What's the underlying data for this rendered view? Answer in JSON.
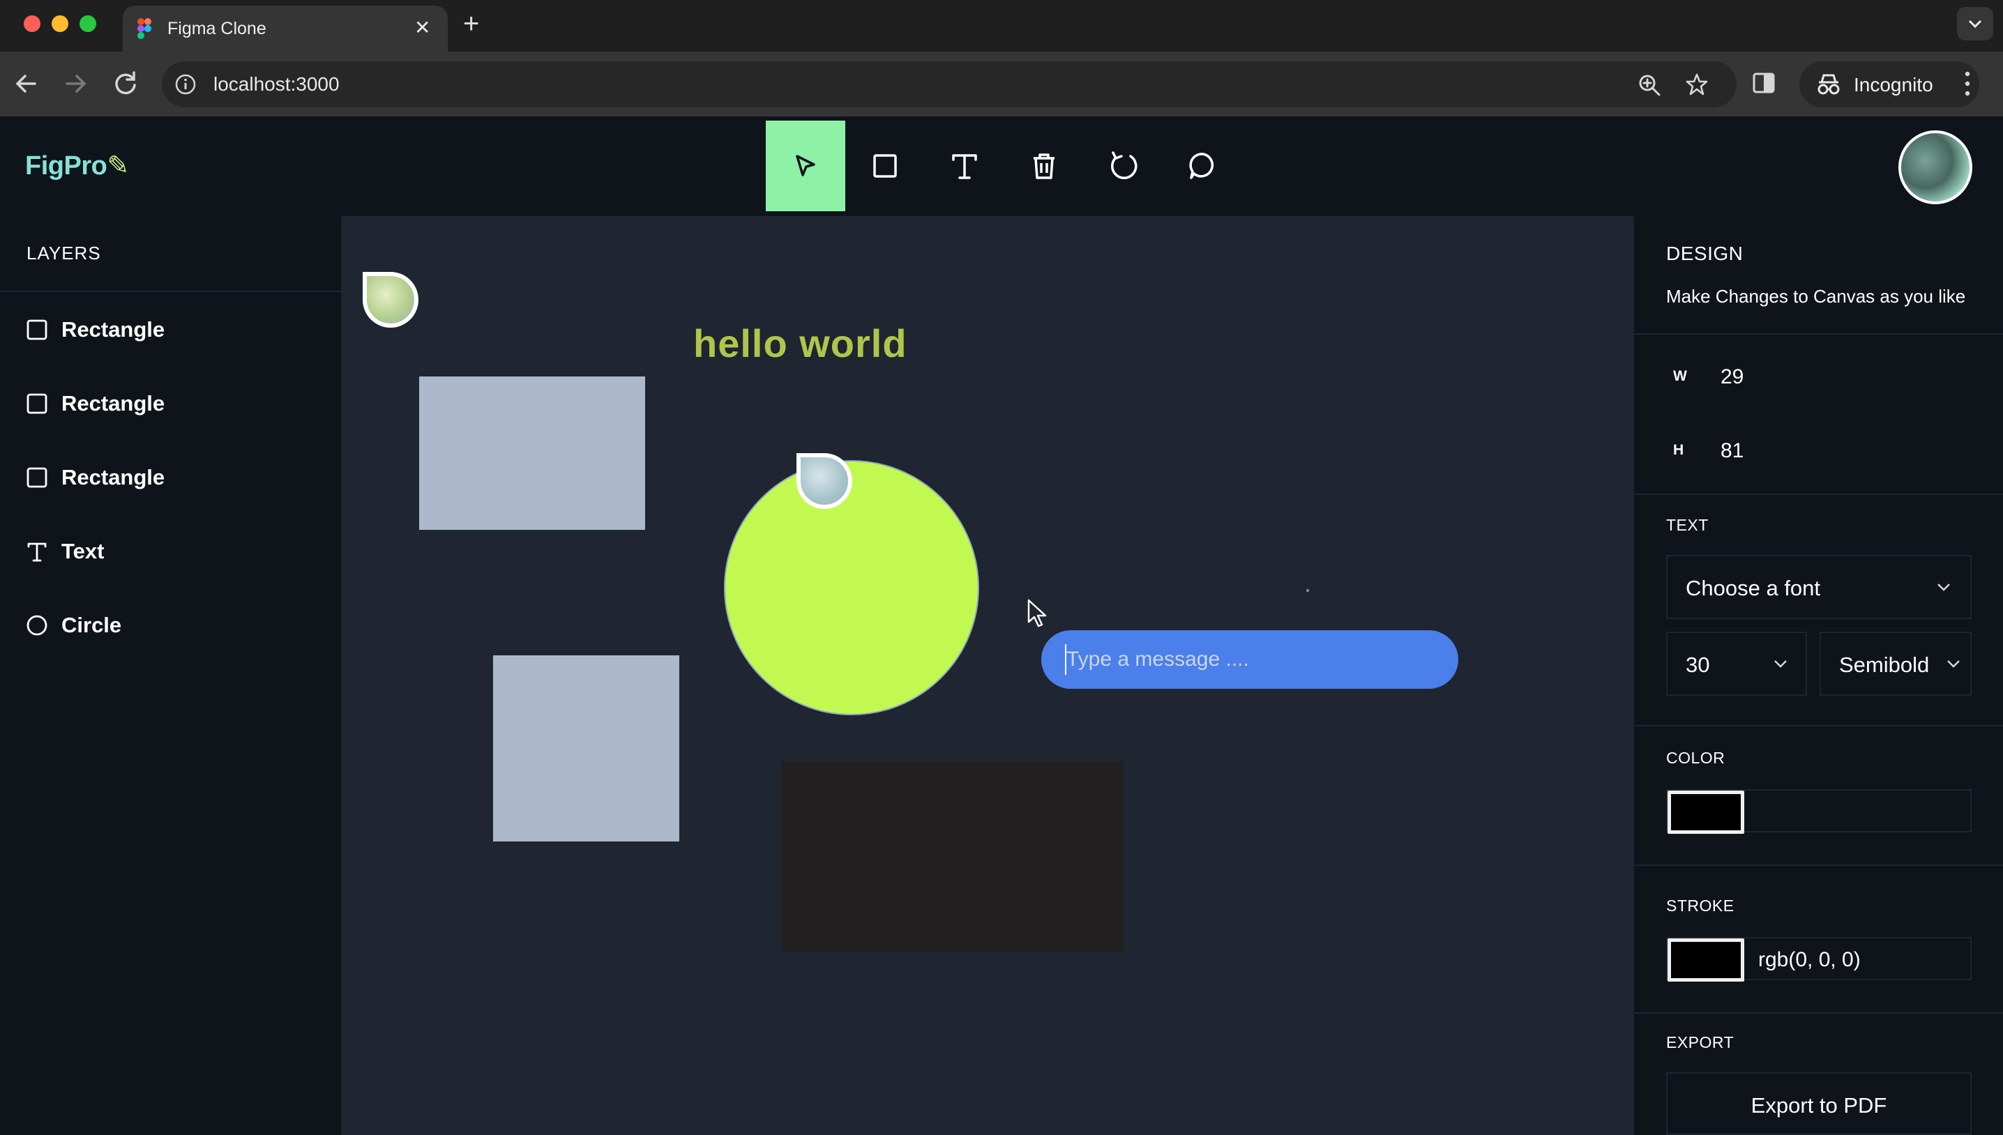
{
  "browser": {
    "tab_title": "Figma Clone",
    "new_tab_symbol": "+",
    "url": "localhost:3000",
    "incognito_label": "Incognito"
  },
  "app": {
    "logo_text": "FigPro",
    "toolbar_tools": [
      "select",
      "rectangle",
      "text",
      "delete",
      "reset",
      "comments"
    ],
    "active_tool": "select",
    "accent_color": "#8df2a6"
  },
  "layers": {
    "heading": "LAYERS",
    "items": [
      {
        "label": "Rectangle",
        "icon": "square-icon"
      },
      {
        "label": "Rectangle",
        "icon": "square-icon"
      },
      {
        "label": "Rectangle",
        "icon": "square-icon"
      },
      {
        "label": "Text",
        "icon": "text-icon"
      },
      {
        "label": "Circle",
        "icon": "circle-icon"
      }
    ]
  },
  "canvas": {
    "text_object": "hello world",
    "shape_colors": {
      "rectangle": "#abb9cb",
      "circle": "#c2f950",
      "dark_rectangle": "#221f21",
      "text": "#b0c64a"
    },
    "chat_placeholder": "Type a message ...."
  },
  "design": {
    "heading": "DESIGN",
    "subtitle": "Make Changes to Canvas as you like",
    "width_label": "W",
    "width_value": "29",
    "height_label": "H",
    "height_value": "81",
    "text_heading": "TEXT",
    "font_placeholder": "Choose a font",
    "font_size": "30",
    "font_weight": "Semibold",
    "color_heading": "COLOR",
    "fill_color": "#000000",
    "stroke_heading": "STROKE",
    "stroke_color": "#000000",
    "stroke_value": "rgb(0, 0, 0)",
    "export_heading": "EXPORT",
    "export_button": "Export to PDF"
  }
}
